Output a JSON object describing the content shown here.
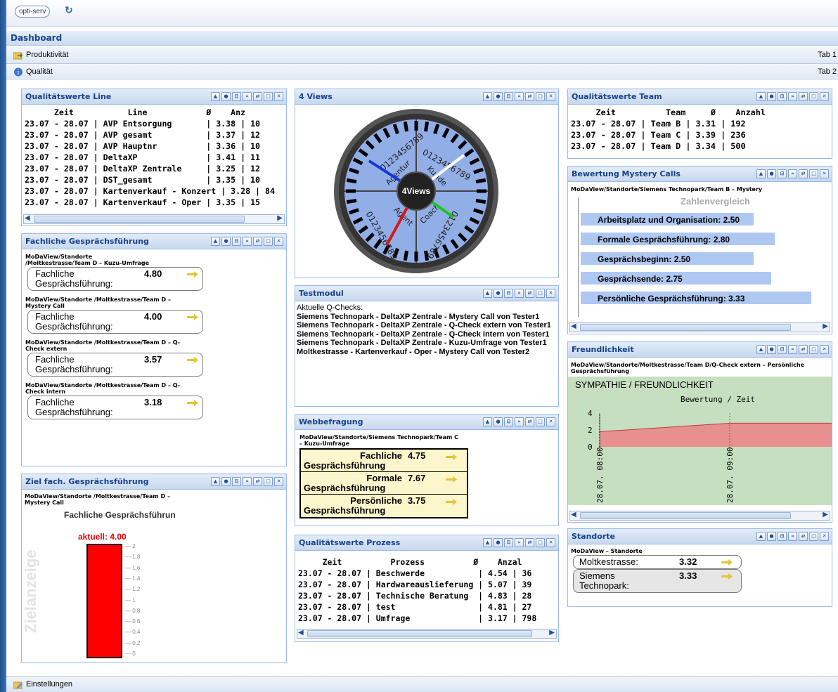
{
  "app": {
    "logo": "opti-serv"
  },
  "dashboard": {
    "title": "Dashboard"
  },
  "nav": [
    {
      "label": "Produktivität",
      "tab": "Tab 1"
    },
    {
      "label": "Qualität",
      "tab": "Tab 2"
    }
  ],
  "footer": {
    "label": "Einstellungen"
  },
  "tools": [
    "▲",
    "●",
    "⊟",
    "»",
    "⇄",
    "□",
    "✕"
  ],
  "qline": {
    "title": "Qualitätswerte Line",
    "header": "      Zeit           Line            Ø    Anz",
    "rows": [
      "23.07 - 28.07 | AVP Entsorgung       | 3.38 | 10",
      "23.07 - 28.07 | AVP gesamt           | 3.37 | 12",
      "23.07 - 28.07 | AVP Hauptnr          | 3.36 | 10",
      "23.07 - 28.07 | DeltaXP              | 3.41 | 11",
      "23.07 - 28.07 | DeltaXP Zentrale     | 3.25 | 12",
      "23.07 - 28.07 | DST_gesamt           | 3.35 | 10",
      "23.07 - 28.07 | Kartenverkauf - Konzert | 3.28 | 84",
      "23.07 - 28.07 | Kartenverkauf - Oper | 3.35 | 15"
    ]
  },
  "fach": {
    "title": "Fachliche Gesprächsführung",
    "items": [
      {
        "path": "MoDaView/Standorte /Moltkestrasse/Team D – Kuzu-Umfrage",
        "label": "Fachliche Gesprächsführung:",
        "value": "4.80"
      },
      {
        "path": "MoDaView/Standorte /Moltkestrasse/Team D – Mystery Call",
        "label": "Fachliche Gesprächsführung:",
        "value": "4.00"
      },
      {
        "path": "MoDaView/Standorte /Moltkestrasse/Team D – Q-Check extern",
        "label": "Fachliche Gesprächsführung:",
        "value": "3.57"
      },
      {
        "path": "MoDaView/Standorte /Moltkestrasse/Team D – Q-Check intern",
        "label": "Fachliche Gesprächsführung:",
        "value": "3.18"
      }
    ]
  },
  "ziel": {
    "title": "Ziel fach. Gesprächsführung",
    "path": "MoDaView/Standorte /Moltkestrasse/Team D – Mystery Call",
    "subtitle": "Fachliche Gesprächsführun",
    "vertical": "Zielanzeige",
    "current_label": "aktuell: 4.00",
    "ticks": [
      "2",
      "1.8",
      "1.6",
      "1.4",
      "1.2",
      "1",
      "0.8",
      "0.6",
      "0.4",
      "0.2",
      "0"
    ],
    "fill_fraction": 1.0
  },
  "views": {
    "title": "4 Views",
    "center": "4Views",
    "quadrants": [
      "Agentur",
      "Kunde",
      "Agent",
      "Coach"
    ],
    "digits": "0123456789"
  },
  "testmodul": {
    "title": "Testmodul",
    "intro": "Aktuelle Q-Checks:",
    "items": [
      "Siemens Technopark - DeltaXP Zentrale - Mystery Call von Tester1",
      "Siemens Technopark - DeltaXP Zentrale - Q-Check extern von Tester1",
      "Siemens Technopark - DeltaXP Zentrale - Q-Check intern von Tester1",
      "Siemens Technopark - DeltaXP Zentrale - Kuzu-Umfrage von Tester1",
      "Moltkestrasse - Kartenverkauf - Oper - Mystery Call von Tester2"
    ]
  },
  "webb": {
    "title": "Webbefragung",
    "path": "MoDaView/Standorte/Siemens Technopark/Team C – Kuzu-Umfrage",
    "rows": [
      {
        "l1": "Fachliche",
        "l2": "Gesprächsführung",
        "value": "4.75"
      },
      {
        "l1": "Formale",
        "l2": "Gesprächsführung",
        "value": "7.67"
      },
      {
        "l1": "Persönliche",
        "l2": "Gesprächsführung",
        "value": "3.75"
      }
    ]
  },
  "qprozess": {
    "title": "Qualitätswerte Prozess",
    "header": "     Zeit          Prozess          Ø    Anzal",
    "rows": [
      "23.07 - 28.07 | Beschwerde           | 4.54 | 36",
      "23.07 - 28.07 | Hardwareauslieferung | 5.07 | 39",
      "23.07 - 28.07 | Technische Beratung  | 4.83 | 28",
      "23.07 - 28.07 | test                 | 4.81 | 27",
      "23.07 - 28.07 | Umfrage              | 3.17 | 798"
    ]
  },
  "qteam": {
    "title": "Qualitätswerte Team",
    "header": "     Zeit          Team     Ø    Anzahl",
    "rows": [
      "23.07 - 28.07 | Team B | 3.31 | 192",
      "23.07 - 28.07 | Team C | 3.39 | 236",
      "23.07 - 28.07 | Team D | 3.34 | 500"
    ]
  },
  "mystery": {
    "title": "Bewertung Mystery Calls",
    "path": "MoDaView/Standorte/Siemens Technopark/Team B – Mystery",
    "chart_title": "Zahlenvergleich",
    "chart_data": {
      "type": "bar",
      "categories": [
        "Arbeitsplatz und Organisation",
        "Formale Gesprächsführung",
        "Gesprächsbeginn",
        "Gesprächsende",
        "Persönliche Gesprächsführung"
      ],
      "values": [
        2.5,
        2.8,
        2.5,
        2.75,
        3.33
      ],
      "labels": [
        "Arbeitsplatz und Organisation: 2.50",
        "Formale Gesprächsführung: 2.80",
        "Gesprächsbeginn: 2.50",
        "Gesprächsende: 2.75",
        "Persönliche Gesprächsführung: 3.33"
      ]
    }
  },
  "freund": {
    "title": "Freundlichkeit",
    "path": "MoDaView/Standorte/Moltkestrasse/Team D/Q-Check extern – Persönliche Gesprächsführung",
    "chart_title": "SYMPATHIE / FREUNDLICHKEIT",
    "subtitle": "Bewertung / Zeit",
    "chart_data": {
      "type": "area",
      "x": [
        "28.07. 08:00",
        "28.07. 09:00"
      ],
      "values": [
        1.8,
        2.8
      ],
      "ylim": [
        0,
        4
      ],
      "yticks": [
        "4",
        "2",
        "0"
      ]
    }
  },
  "standorte": {
    "title": "Standorte",
    "path": "MoDaView – Standorte",
    "items": [
      {
        "label": "Moltkestrasse:",
        "value": "3.32"
      },
      {
        "label": "Siemens Technopark:",
        "value": "3.33"
      }
    ]
  }
}
